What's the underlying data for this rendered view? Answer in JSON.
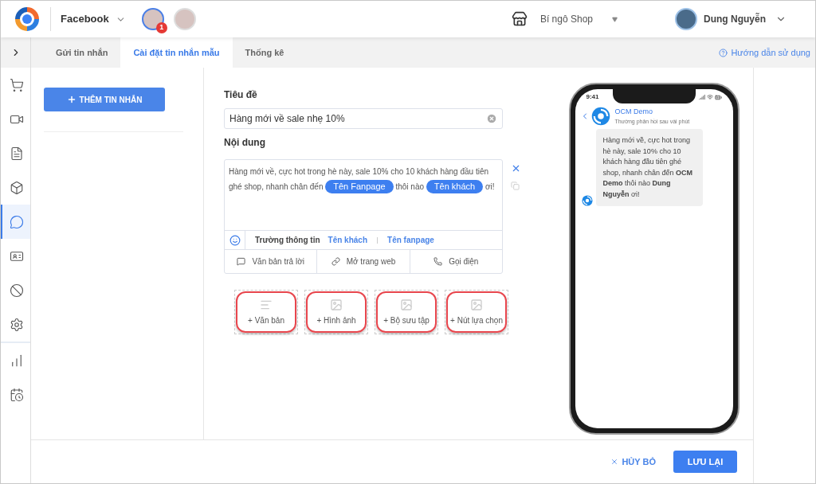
{
  "header": {
    "channel": "Facebook",
    "pages": [
      {
        "badge": "1",
        "selected": true
      },
      {
        "selected": false
      }
    ],
    "shop": "Bí ngô Shop",
    "user": "Dung Nguyễn"
  },
  "sidebar": {
    "items": [
      {
        "kind": "cart",
        "selected": false
      },
      {
        "kind": "video",
        "selected": false
      },
      {
        "kind": "doc",
        "selected": false
      },
      {
        "kind": "box",
        "selected": false
      },
      {
        "kind": "chat",
        "selected": true
      },
      {
        "kind": "card",
        "selected": false
      },
      {
        "kind": "ban",
        "selected": false
      },
      {
        "kind": "settings",
        "selected": false
      },
      {
        "kind": "chart",
        "selected": false
      },
      {
        "kind": "schedule",
        "selected": false
      }
    ]
  },
  "tabs": [
    {
      "label": "Gửi tin nhắn",
      "selected": false
    },
    {
      "label": "Cài đặt tin nhắn mẫu",
      "selected": true
    },
    {
      "label": "Thống kê",
      "selected": false
    }
  ],
  "help_link": "Hướng dẫn sử dụng",
  "add_button": "THÊM TIN NHẮN",
  "form": {
    "title_label": "Tiêu đề",
    "title_value": "Hàng mới về sale nhẹ 10%",
    "content_label": "Nội dung",
    "content": [
      {
        "kind": "text",
        "text": "Hàng mới về, cực hot trong hè này, sale 10% cho 10 khách hàng đầu tiên ghé shop, nhanh chân đến "
      },
      {
        "kind": "tag",
        "text": "Tên Fanpage"
      },
      {
        "kind": "text",
        "text": " thôi nào "
      },
      {
        "kind": "tag",
        "text": "Tên khách"
      },
      {
        "kind": "text",
        "text": " ơi!"
      }
    ],
    "fields_label": "Trường thông tin",
    "fields": [
      "Tên khách",
      "Tên fanpage"
    ],
    "actions": [
      {
        "kind": "reply",
        "label": "Văn bản trả lời"
      },
      {
        "kind": "link",
        "label": "Mở trang web"
      },
      {
        "kind": "phone",
        "label": "Gọi điện"
      }
    ],
    "blocks": [
      {
        "kind": "text",
        "label": "+ Văn bản"
      },
      {
        "kind": "image",
        "label": "+ Hình ảnh"
      },
      {
        "kind": "image",
        "label": "+ Bộ sưu tập"
      },
      {
        "kind": "image",
        "label": "+ Nút lựa chọn"
      }
    ]
  },
  "preview": {
    "time": "9:41",
    "name": "OCM Demo",
    "status": "Thường phản hồi sau vài phút",
    "message": "Hàng mới về, cực hot trong hè này, sale 10% cho 10 khách hàng đầu tiên ghé shop, nhanh chân đến **OCM Demo** thôi nào **Dung Nguyễn** ơi!"
  },
  "footer": {
    "cancel": "HỦY BỎ",
    "save": "LƯU LẠI"
  }
}
